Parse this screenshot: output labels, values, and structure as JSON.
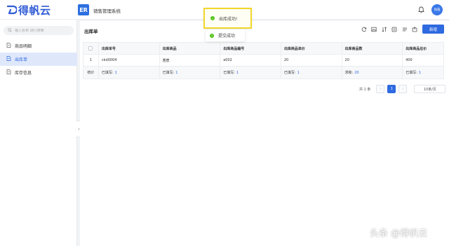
{
  "app": {
    "logo_text": "得帆云",
    "system_icon_text": "ER",
    "system_title": "销售管理系统",
    "avatar_text": "徐菡"
  },
  "sidebar": {
    "search_placeholder": "输入名称 进行搜索",
    "items": [
      {
        "label": "商品明细",
        "active": false
      },
      {
        "label": "出库单",
        "active": true
      },
      {
        "label": "库存信息",
        "active": false
      }
    ]
  },
  "main": {
    "title": "出库单",
    "add_button": "新增",
    "tool_icons": [
      "refresh-icon",
      "image-icon",
      "sort-icon",
      "settings-icon",
      "columns-icon",
      "export-icon"
    ]
  },
  "table": {
    "headers": [
      "",
      "出库单号",
      "出库商品",
      "出库商品编号",
      "出库商品单价",
      "出库商品数",
      "出库商品总价"
    ],
    "rows": [
      [
        "1",
        "ckd0004",
        "香蕉",
        "a002",
        "20",
        "20",
        "400"
      ]
    ],
    "summary": {
      "label": "统计",
      "cells": [
        {
          "prefix": "已填写:",
          "value": "1"
        },
        {
          "prefix": "已填写:",
          "value": "1"
        },
        {
          "prefix": "已填写:",
          "value": "1"
        },
        {
          "prefix": "已填写:",
          "value": "1"
        },
        {
          "prefix": "求和:",
          "value": "20"
        },
        {
          "prefix": "已填写:",
          "value": "1"
        }
      ]
    }
  },
  "pagination": {
    "total_text": "共 1 条",
    "prev": "‹",
    "current": "1",
    "next": "›",
    "page_size": "10条/页"
  },
  "toasts": {
    "primary": "出库成功!",
    "secondary": "提交成功"
  },
  "watermark": "头条 @得帆云",
  "colors": {
    "accent": "#2f6ae0",
    "success": "#52c41a",
    "highlight": "#f0d72a"
  }
}
